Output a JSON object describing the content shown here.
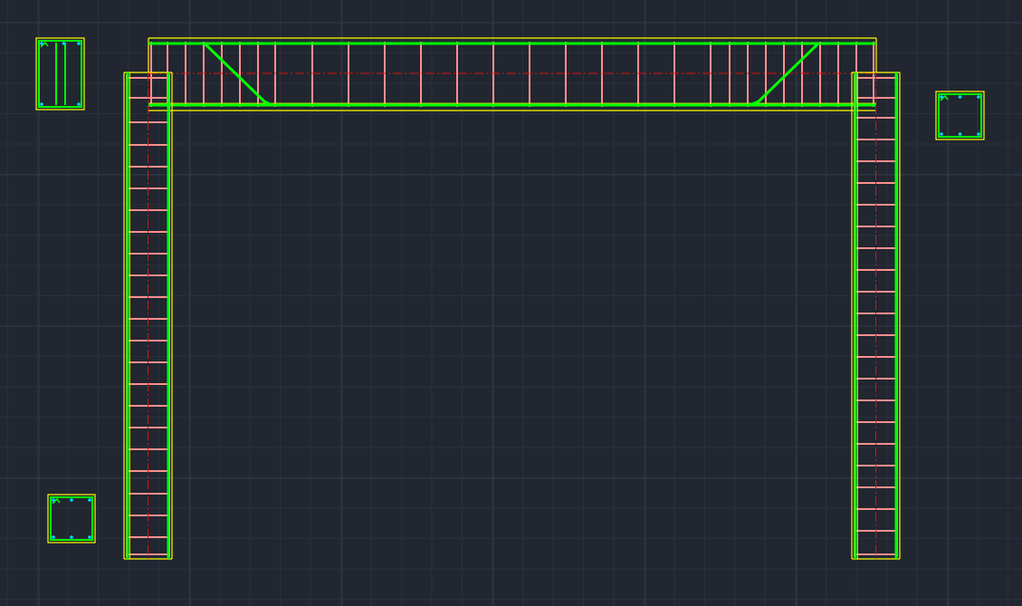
{
  "drawing": {
    "title": "",
    "colors": {
      "background": "#212630",
      "grid_minor": "#2a303b",
      "grid_major": "#333a47",
      "concrete_outline": "#ffff00",
      "main_rebar": "#00ff00",
      "stirrups": "#ff8f8f",
      "centerline": "#e01010",
      "section_outline": "#00ff00",
      "rebar_dots": "#00d8ff"
    },
    "members": [
      {
        "name": "beam",
        "orientation": "horizontal",
        "bent_up_bars": 2
      },
      {
        "name": "left-column",
        "orientation": "vertical"
      },
      {
        "name": "right-column",
        "orientation": "vertical"
      }
    ],
    "sections": [
      {
        "name": "beam-section",
        "shape": "tall-rectangle",
        "longitudinal_bars": 4,
        "inner_legs": 2
      },
      {
        "name": "right-column-section",
        "shape": "square",
        "longitudinal_bars": 6
      },
      {
        "name": "left-column-section",
        "shape": "square",
        "longitudinal_bars": 6
      }
    ]
  }
}
